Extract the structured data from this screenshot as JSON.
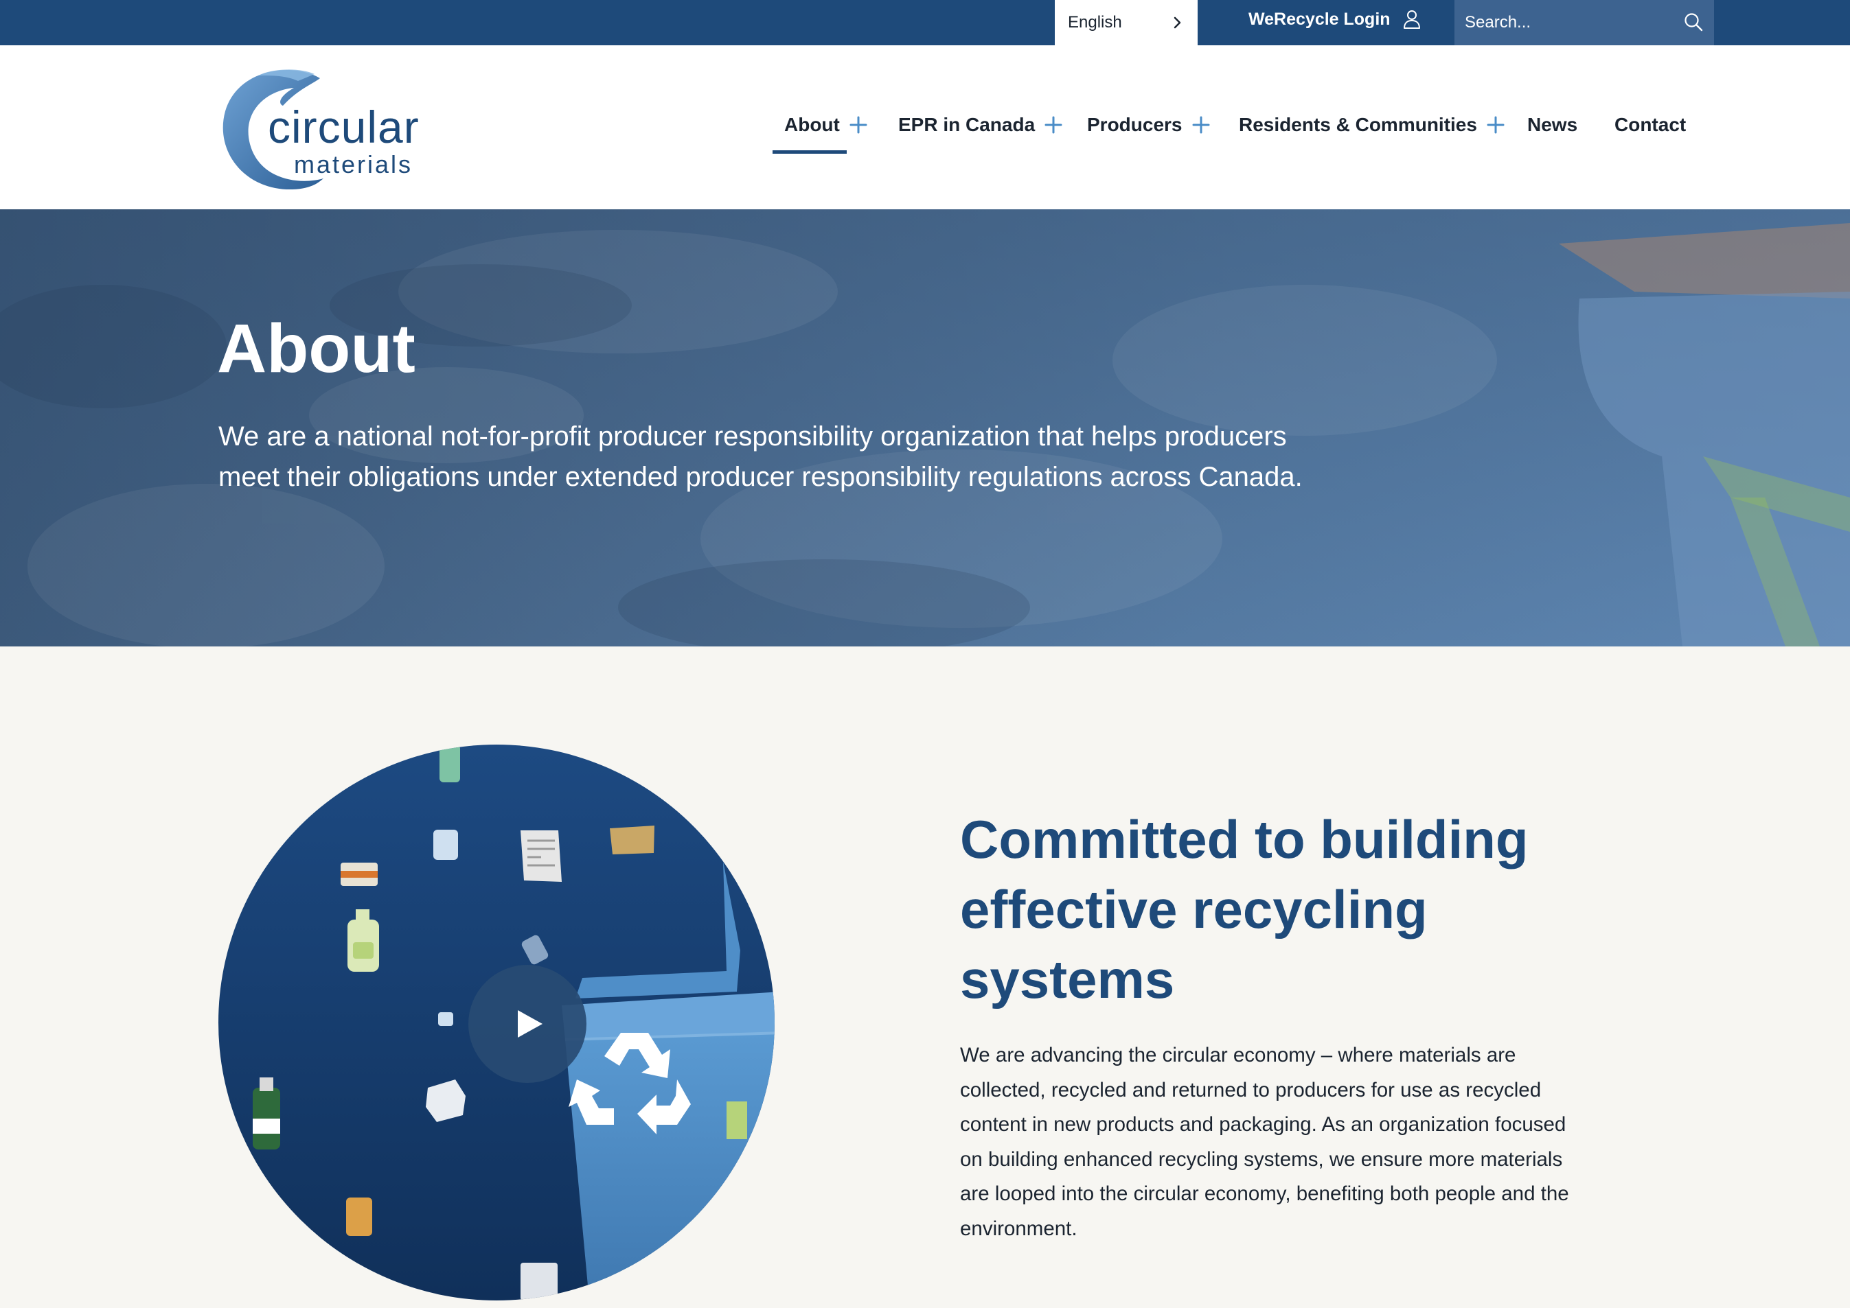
{
  "utility_bar": {
    "language": "English",
    "login_label": "WeRecycle Login",
    "search_placeholder": "Search..."
  },
  "logo": {
    "word1": "circular",
    "word2": "materials"
  },
  "nav": {
    "items": [
      {
        "label": "About",
        "has_submenu": true,
        "active": true
      },
      {
        "label": "EPR in Canada",
        "has_submenu": true,
        "active": false
      },
      {
        "label": "Producers",
        "has_submenu": true,
        "active": false
      },
      {
        "label": "Residents & Communities",
        "has_submenu": true,
        "active": false
      },
      {
        "label": "News",
        "has_submenu": false,
        "active": false
      },
      {
        "label": "Contact",
        "has_submenu": false,
        "active": false
      }
    ]
  },
  "hero": {
    "title": "About",
    "text": "We are a national not-for-profit producer responsibility organization that helps producers meet their obligations under extended producer responsibility regulations across Canada."
  },
  "section": {
    "title": "Committed to building effective recycling systems",
    "text": "We are advancing the circular economy – where materials are collected, recycled and returned to producers for use as recycled content in new products and packaging. As an organization focused on building enhanced recycling systems, we ensure more materials are looped into the circular economy, benefiting both people and the environment."
  },
  "video": {
    "icons": [
      "play-icon",
      "recycle-icon",
      "recycling-bin-illustration"
    ]
  },
  "colors": {
    "brand_navy": "#1e4a7a",
    "brand_blue": "#4a8cc7",
    "search_bg": "#3d6390",
    "page_bg": "#f7f6f2"
  }
}
